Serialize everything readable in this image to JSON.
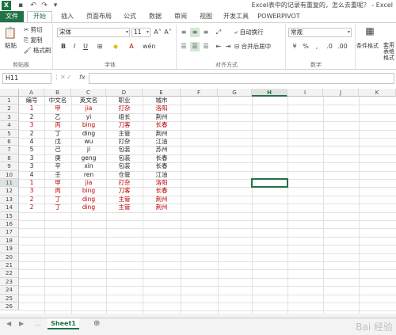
{
  "window": {
    "title": "Excel表中的记录有重复的，怎么去重呢？ - Excel"
  },
  "tabs": [
    {
      "label": "文件"
    },
    {
      "label": "开始"
    },
    {
      "label": "插入"
    },
    {
      "label": "页面布局"
    },
    {
      "label": "公式"
    },
    {
      "label": "数据"
    },
    {
      "label": "审阅"
    },
    {
      "label": "视图"
    },
    {
      "label": "开发工具"
    },
    {
      "label": "POWERPIVOT"
    }
  ],
  "ribbon": {
    "paste": "粘贴",
    "cut": "剪切",
    "copy": "复制",
    "format_painter": "格式刷",
    "clipboard": "剪贴板",
    "font_name": "宋体",
    "font_size": "11",
    "font_group": "字体",
    "wrap": "自动换行",
    "merge": "合并后居中",
    "align_group": "对齐方式",
    "number_format": "常规",
    "number_group": "数字",
    "cond_format": "条件格式",
    "insert_short": "套用\n表格格式"
  },
  "formula_bar": {
    "name_box": "H11",
    "fx": "fx"
  },
  "columns": [
    "A",
    "B",
    "C",
    "D",
    "E",
    "F",
    "G",
    "H",
    "I",
    "J",
    "K"
  ],
  "selected_column": "H",
  "selected_row": "11",
  "rows": [
    "1",
    "2",
    "3",
    "4",
    "5",
    "6",
    "7",
    "8",
    "9",
    "10",
    "11",
    "12",
    "13",
    "14",
    "15",
    "16",
    "17",
    "18",
    "19",
    "20",
    "21",
    "22",
    "23",
    "24",
    "25",
    "26"
  ],
  "table": {
    "header": [
      "编号",
      "中文名",
      "英文名",
      "职业",
      "城市"
    ],
    "data": [
      {
        "cells": [
          "1",
          "甲",
          "jia",
          "打杂",
          "洛阳"
        ],
        "red": true
      },
      {
        "cells": [
          "2",
          "乙",
          "yi",
          "组长",
          "荆州"
        ],
        "red": false
      },
      {
        "cells": [
          "3",
          "丙",
          "bing",
          "刀客",
          "长春"
        ],
        "red": true
      },
      {
        "cells": [
          "2",
          "丁",
          "ding",
          "主管",
          "荆州"
        ],
        "red": false
      },
      {
        "cells": [
          "4",
          "戊",
          "wu",
          "打杂",
          "江油"
        ],
        "red": false
      },
      {
        "cells": [
          "5",
          "己",
          "ji",
          "包装",
          "苏州"
        ],
        "red": false
      },
      {
        "cells": [
          "3",
          "庚",
          "geng",
          "包装",
          "长春"
        ],
        "red": false
      },
      {
        "cells": [
          "3",
          "辛",
          "xin",
          "包装",
          "长春"
        ],
        "red": false
      },
      {
        "cells": [
          "4",
          "壬",
          "ren",
          "仓管",
          "江油"
        ],
        "red": false
      },
      {
        "cells": [
          "1",
          "甲",
          "jia",
          "打杂",
          "洛阳"
        ],
        "red": true
      },
      {
        "cells": [
          "3",
          "丙",
          "bing",
          "刀客",
          "长春"
        ],
        "red": true
      },
      {
        "cells": [
          "2",
          "丁",
          "ding",
          "主管",
          "荆州"
        ],
        "red": true
      },
      {
        "cells": [
          "2",
          "丁",
          "ding",
          "主管",
          "荆州"
        ],
        "red": true
      }
    ]
  },
  "sheets": [
    {
      "name": "Sheet1"
    }
  ],
  "add_sheet": "⊕",
  "watermark": "Bai 经验",
  "colors": {
    "accent": "#217346",
    "dup_red": "#c00000"
  }
}
